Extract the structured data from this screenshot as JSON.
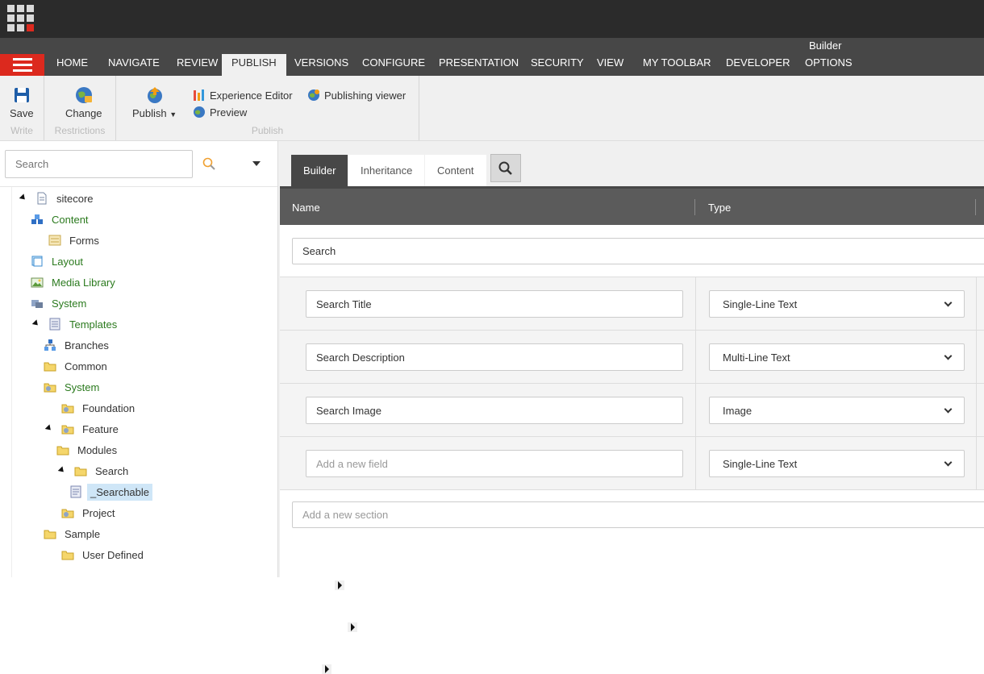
{
  "ribbon_tabs": [
    {
      "label": "HOME"
    },
    {
      "label": "NAVIGATE"
    },
    {
      "label": "REVIEW"
    },
    {
      "label": "PUBLISH"
    },
    {
      "label": "VERSIONS"
    },
    {
      "label": "CONFIGURE"
    },
    {
      "label": "PRESENTATION"
    },
    {
      "label": "SECURITY"
    },
    {
      "label": "VIEW"
    },
    {
      "label": "MY TOOLBAR"
    },
    {
      "label": "DEVELOPER"
    },
    {
      "label": "OPTIONS"
    }
  ],
  "contextual_tab_group": "Builder",
  "active_ribbon_tab": "PUBLISH",
  "ribbon": {
    "write": {
      "save_label": "Save",
      "group_label": "Write"
    },
    "restrictions": {
      "change_label": "Change",
      "group_label": "Restrictions"
    },
    "publish": {
      "publish_label": "Publish",
      "experience_editor_label": "Experience Editor",
      "preview_label": "Preview",
      "publishing_viewer_label": "Publishing viewer",
      "group_label": "Publish"
    }
  },
  "tree": {
    "search_placeholder": "Search",
    "nodes": [
      {
        "label": "sitecore",
        "icon": "document-icon",
        "expander": "expanded",
        "color": "default"
      },
      {
        "label": "Content",
        "icon": "content-cubes-icon",
        "expander": "collapsed",
        "color": "green"
      },
      {
        "label": "Forms",
        "icon": "forms-icon",
        "expander": "none",
        "color": "default"
      },
      {
        "label": "Layout",
        "icon": "layout-icon",
        "expander": "collapsed",
        "color": "green"
      },
      {
        "label": "Media Library",
        "icon": "media-library-icon",
        "expander": "collapsed",
        "color": "green"
      },
      {
        "label": "System",
        "icon": "system-icon",
        "expander": "collapsed",
        "color": "green"
      },
      {
        "label": "Templates",
        "icon": "templates-icon",
        "expander": "expanded",
        "color": "green"
      },
      {
        "label": "Branches",
        "icon": "branches-icon",
        "expander": "collapsed",
        "color": "default"
      },
      {
        "label": "Common",
        "icon": "folder-icon",
        "expander": "collapsed",
        "color": "default"
      },
      {
        "label": "System",
        "icon": "folder-gear-icon",
        "expander": "collapsed",
        "color": "green"
      },
      {
        "label": "Foundation",
        "icon": "folder-gear-icon",
        "expander": "none",
        "color": "default"
      },
      {
        "label": "Feature",
        "icon": "folder-gear-icon",
        "expander": "expanded",
        "color": "default"
      },
      {
        "label": "Modules",
        "icon": "folder-icon",
        "expander": "collapsed",
        "color": "default"
      },
      {
        "label": "Search",
        "icon": "folder-icon",
        "expander": "expanded",
        "color": "default"
      },
      {
        "label": "_Searchable",
        "icon": "template-icon",
        "expander": "collapsed",
        "color": "default",
        "selected": true
      },
      {
        "label": "Project",
        "icon": "folder-gear-icon",
        "expander": "none",
        "color": "default"
      },
      {
        "label": "Sample",
        "icon": "folder-icon",
        "expander": "collapsed",
        "color": "default"
      },
      {
        "label": "User Defined",
        "icon": "folder-icon",
        "expander": "none",
        "color": "default"
      }
    ]
  },
  "editor_tabs": [
    {
      "label": "Builder"
    },
    {
      "label": "Inheritance"
    },
    {
      "label": "Content"
    }
  ],
  "builder": {
    "header_name": "Name",
    "header_type": "Type",
    "section_name": "Search",
    "fields": [
      {
        "name": "Search Title",
        "type": "Single-Line Text"
      },
      {
        "name": "Search Description",
        "type": "Multi-Line Text"
      },
      {
        "name": "Search Image",
        "type": "Image"
      }
    ],
    "new_field_placeholder": "Add a new field",
    "new_field_type": "Single-Line Text",
    "new_section_placeholder": "Add a new section"
  },
  "colors": {
    "topbar": "#2b2b2b",
    "ribbon_tabs_bg": "#474747",
    "accent_red": "#dc291e",
    "tree_green": "#2b7a1e",
    "selected_node": "#cfe6f7"
  }
}
